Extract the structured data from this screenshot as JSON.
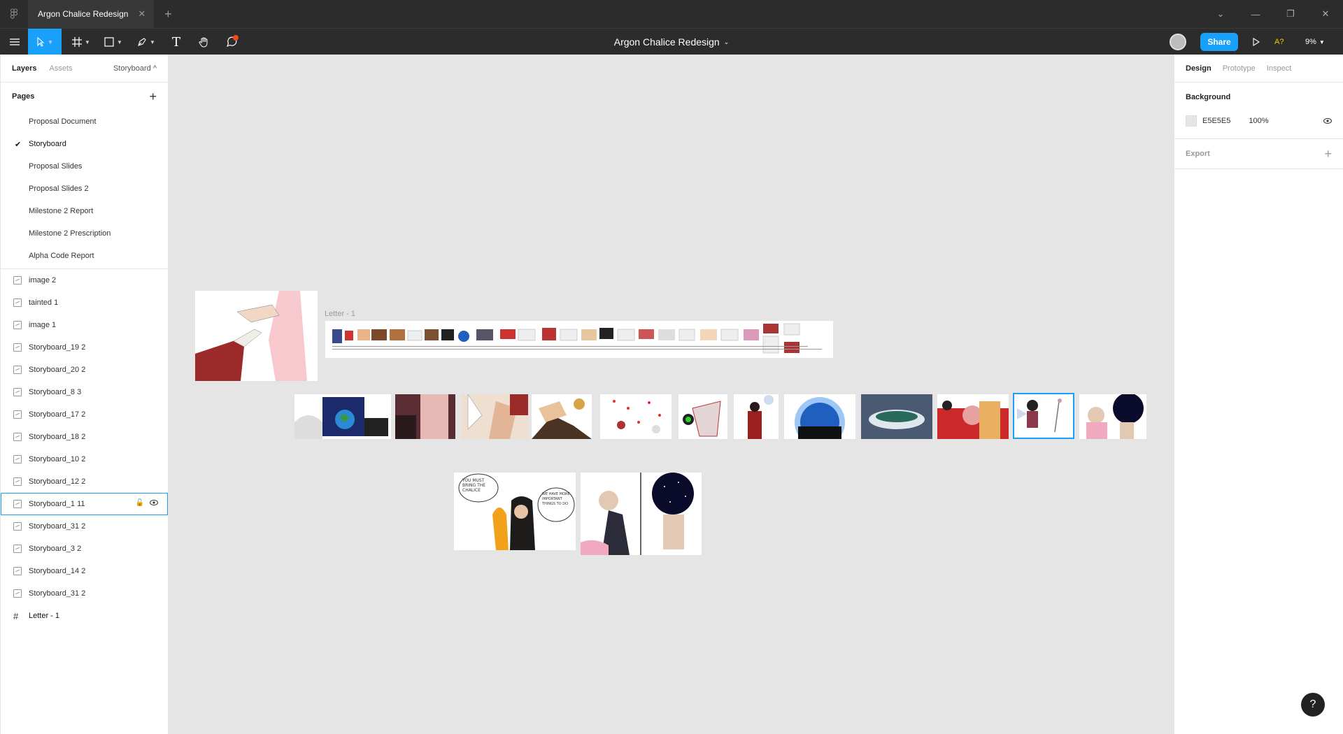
{
  "titlebar": {
    "tab_title": "Argon Chalice Redesign",
    "tab_close": "✕",
    "new_tab": "+",
    "minimize": "⌄",
    "min2": "—",
    "restore": "❐",
    "close": "✕"
  },
  "toolbar": {
    "doc_title": "Argon Chalice Redesign",
    "share_label": "Share",
    "font_warning": "A?",
    "zoom": "9%"
  },
  "left_panel": {
    "tabs": [
      "Layers",
      "Assets"
    ],
    "page_selector": "Storyboard ^",
    "pages_header": "Pages",
    "pages": [
      {
        "label": "Proposal Document",
        "current": false
      },
      {
        "label": "Storyboard",
        "current": true
      },
      {
        "label": "Proposal Slides",
        "current": false
      },
      {
        "label": "Proposal Slides 2",
        "current": false
      },
      {
        "label": "Milestone 2 Report",
        "current": false
      },
      {
        "label": "Milestone 2 Prescription",
        "current": false
      },
      {
        "label": "Alpha Code Report",
        "current": false
      }
    ],
    "layers": [
      "image 2",
      "tainted 1",
      "image 1",
      "Storyboard_19 2",
      "Storyboard_20 2",
      "Storyboard_8 3",
      "Storyboard_17 2",
      "Storyboard_18 2",
      "Storyboard_10 2",
      "Storyboard_12 2",
      "Storyboard_1 11",
      "Storyboard_31 2",
      "Storyboard_3 2",
      "Storyboard_14 2",
      "Storyboard_31 2"
    ],
    "selected_layer_index": 10,
    "frame_layer": "Letter - 1"
  },
  "canvas": {
    "frame_label": "Letter - 1",
    "speech_1": "YOU MUST BRING THE CHALICE",
    "speech_2": "WE HAVE MORE IMPORTANT THINGS TO DO"
  },
  "right_panel": {
    "tabs": [
      "Design",
      "Prototype",
      "Inspect"
    ],
    "background_header": "Background",
    "bg_hex": "E5E5E5",
    "bg_opacity": "100%",
    "export_header": "Export"
  },
  "colors": {
    "accent": "#18a0fb",
    "chrome": "#2c2c2c",
    "canvas_bg": "#e5e5e5"
  }
}
